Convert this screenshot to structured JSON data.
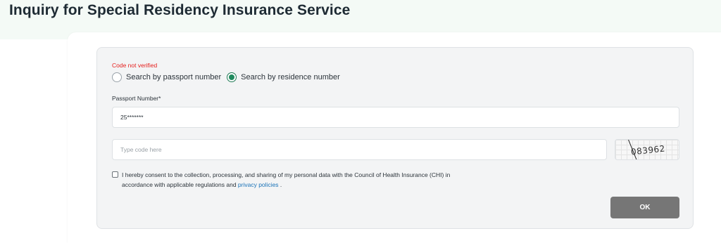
{
  "page": {
    "title": "Inquiry for Special Residency Insurance Service"
  },
  "form": {
    "error_text": "Code not verified",
    "search_options": [
      {
        "label": "Search by passport number",
        "selected": false
      },
      {
        "label": "Search by residence number",
        "selected": true
      }
    ],
    "passport_label": "Passport Number*",
    "passport_value": "25*******",
    "code_placeholder": "Type code here",
    "captcha_text": "083962",
    "consent": {
      "checked": false,
      "text_before": "I hereby consent to the collection, processing, and sharing of my personal data with the Council of Health Insurance (CHI) in accordance with applicable regulations and ",
      "link_text": "privacy policies",
      "text_after": " ."
    },
    "ok_label": "OK"
  },
  "colors": {
    "accent": "#1f8a5e",
    "error": "#e5201e",
    "link": "#1a73b8",
    "button": "#767676"
  }
}
